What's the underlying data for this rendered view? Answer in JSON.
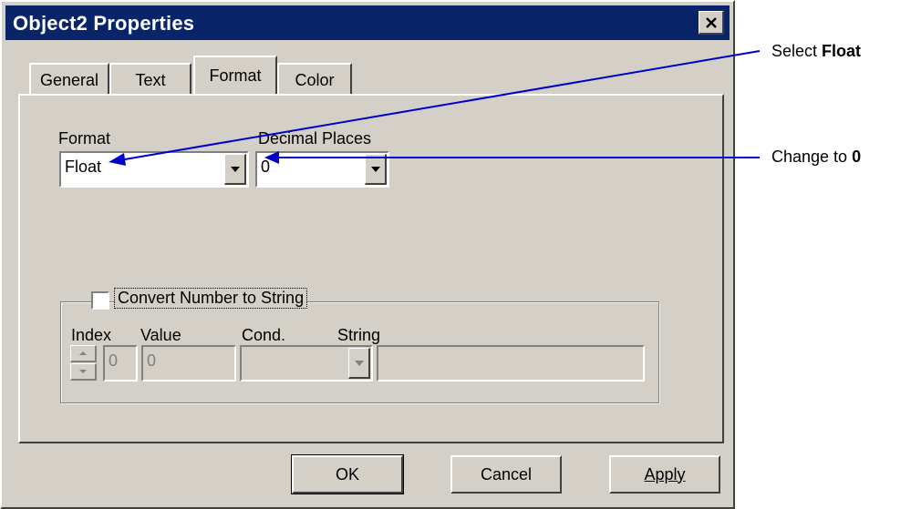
{
  "dialog": {
    "title": "Object2 Properties",
    "close_glyph": "✕"
  },
  "tabs": [
    {
      "label": "General",
      "active": false
    },
    {
      "label": "Text",
      "active": false
    },
    {
      "label": "Format",
      "active": true
    },
    {
      "label": "Color",
      "active": false
    }
  ],
  "format_tab": {
    "format_label": "Format",
    "format_value": "Float",
    "decimal_label": "Decimal Places",
    "decimal_value": "0"
  },
  "convert_group": {
    "checkbox_label": "Convert Number to String",
    "checked": false,
    "index_label": "Index",
    "index_value": "0",
    "value_label": "Value",
    "value_value": "0",
    "cond_label": "Cond.",
    "cond_value": "",
    "string_label": "String",
    "string_value": ""
  },
  "buttons": {
    "ok": "OK",
    "cancel": "Cancel",
    "apply": "Apply"
  },
  "annotations": {
    "select_prefix": "Select ",
    "select_value": "Float",
    "change_prefix": "Change to ",
    "change_value": "0",
    "arrow_color": "#0000cc"
  }
}
